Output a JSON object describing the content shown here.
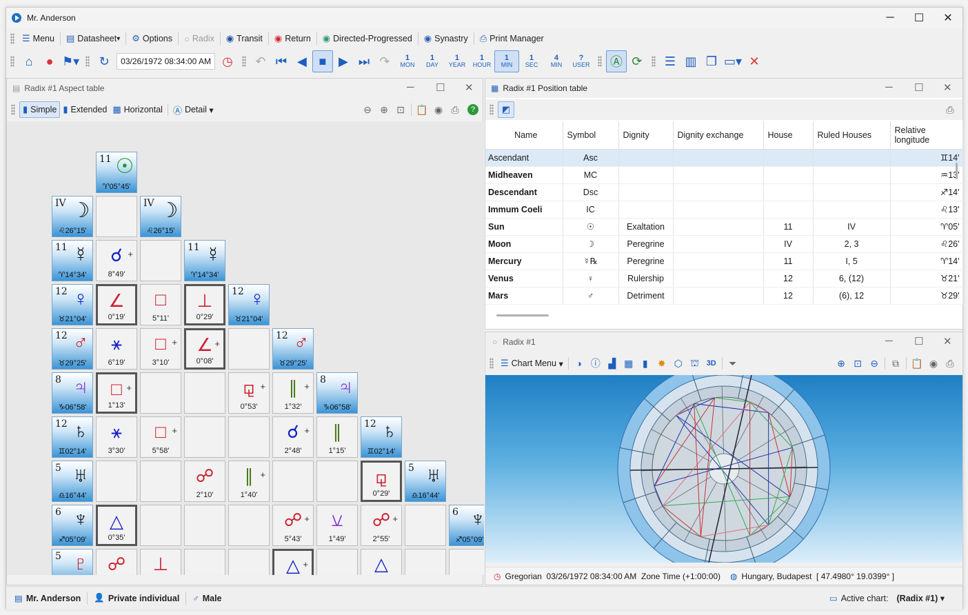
{
  "window": {
    "title": "Mr. Anderson"
  },
  "menubar": [
    {
      "label": "Menu",
      "icon": "hamburger-icon",
      "disabled": false
    },
    {
      "label": "Datasheet",
      "icon": "datasheet-icon",
      "disabled": false
    },
    {
      "label": "Options",
      "icon": "gear-icon",
      "disabled": false
    },
    {
      "label": "Radix",
      "icon": "radio-icon",
      "disabled": true
    },
    {
      "label": "Transit",
      "icon": "transit-icon",
      "disabled": false
    },
    {
      "label": "Return",
      "icon": "return-icon",
      "disabled": false
    },
    {
      "label": "Directed-Progressed",
      "icon": "progressed-icon",
      "disabled": false
    },
    {
      "label": "Synastry",
      "icon": "synastry-icon",
      "disabled": false
    },
    {
      "label": "Print Manager",
      "icon": "printer-icon",
      "disabled": false
    }
  ],
  "toolbar": {
    "datetime": "03/26/1972 08:34:00 AM",
    "steps": [
      {
        "top": "1",
        "label": "MON"
      },
      {
        "top": "1",
        "label": "DAY"
      },
      {
        "top": "1",
        "label": "YEAR"
      },
      {
        "top": "1",
        "label": "HOUR"
      },
      {
        "top": "1",
        "label": "MIN"
      },
      {
        "top": "1",
        "label": "SEC"
      },
      {
        "top": "4",
        "label": "MIN"
      },
      {
        "top": "?",
        "label": "USER"
      }
    ]
  },
  "aspect_panel": {
    "title": "Radix #1 Aspect table",
    "tools": {
      "simple": "Simple",
      "extended": "Extended",
      "horizontal": "Horizontal",
      "detail": "Detail"
    },
    "planets": [
      {
        "house": "11",
        "glyph": "☉",
        "pos": "♈05°45'",
        "color": "#1a9a2a"
      },
      {
        "house": "IV",
        "glyph": "☽",
        "pos": "♌26°15'",
        "color": "#111"
      },
      {
        "house": "11",
        "glyph": "☿",
        "pos": "♈14°34'",
        "color": "#111"
      },
      {
        "house": "12",
        "glyph": "♀",
        "pos": "♉21°04'",
        "color": "#1520c8"
      },
      {
        "house": "12",
        "glyph": "♂",
        "pos": "♉29°25'",
        "color": "#cc1f2f"
      },
      {
        "house": "8",
        "glyph": "♃",
        "pos": "♑06°58'",
        "color": "#8a2fd0"
      },
      {
        "house": "12",
        "glyph": "♄",
        "pos": "♊02°14'",
        "color": "#111"
      },
      {
        "house": "5",
        "glyph": "♅",
        "pos": "♎16°44'",
        "color": "#111"
      },
      {
        "house": "6",
        "glyph": "♆",
        "pos": "♐05°09'",
        "color": "#111"
      },
      {
        "house": "5",
        "glyph": "♇",
        "pos": "",
        "color": "#cc1f2f"
      }
    ],
    "aspects": [
      {
        "r": 3,
        "c": 1,
        "g": "☌",
        "col": "#1520c8",
        "orb": "8°49'",
        "plus": true,
        "bold": false
      },
      {
        "r": 4,
        "c": 1,
        "g": "∠",
        "col": "#cc1f2f",
        "orb": "0°19'",
        "plus": false,
        "bold": true
      },
      {
        "r": 4,
        "c": 2,
        "g": "□",
        "col": "#cc1f2f",
        "orb": "5°11'",
        "plus": false,
        "bold": false
      },
      {
        "r": 4,
        "c": 3,
        "g": "⊥",
        "col": "#cc1f2f",
        "orb": "0°29'",
        "plus": false,
        "bold": true
      },
      {
        "r": 5,
        "c": 1,
        "g": "⚹",
        "col": "#1520c8",
        "orb": "6°19'",
        "plus": false,
        "bold": false
      },
      {
        "r": 5,
        "c": 2,
        "g": "□",
        "col": "#cc1f2f",
        "orb": "3°10'",
        "plus": true,
        "bold": false
      },
      {
        "r": 5,
        "c": 3,
        "g": "∠",
        "col": "#cc1f2f",
        "orb": "0°08'",
        "plus": true,
        "bold": true
      },
      {
        "r": 6,
        "c": 1,
        "g": "□",
        "col": "#cc1f2f",
        "orb": "1°13'",
        "plus": true,
        "bold": true
      },
      {
        "r": 6,
        "c": 4,
        "g": "⚼",
        "col": "#cc1f2f",
        "orb": "0°53'",
        "plus": true,
        "bold": false
      },
      {
        "r": 6,
        "c": 5,
        "g": "∥",
        "col": "#4a7a1a",
        "orb": "1°32'",
        "plus": true,
        "bold": false
      },
      {
        "r": 7,
        "c": 1,
        "g": "⚹",
        "col": "#1520c8",
        "orb": "3°30'",
        "plus": false,
        "bold": false
      },
      {
        "r": 7,
        "c": 2,
        "g": "□",
        "col": "#cc1f2f",
        "orb": "5°58'",
        "plus": true,
        "bold": false
      },
      {
        "r": 7,
        "c": 5,
        "g": "☌",
        "col": "#1520c8",
        "orb": "2°48'",
        "plus": true,
        "bold": false
      },
      {
        "r": 7,
        "c": 6,
        "g": "∥",
        "col": "#4a7a1a",
        "orb": "1°15'",
        "plus": false,
        "bold": false
      },
      {
        "r": 8,
        "c": 3,
        "g": "☍",
        "col": "#cc1f2f",
        "orb": "2°10'",
        "plus": false,
        "bold": false
      },
      {
        "r": 8,
        "c": 4,
        "g": "∥",
        "col": "#4a7a1a",
        "orb": "1°40'",
        "plus": true,
        "bold": false
      },
      {
        "r": 8,
        "c": 7,
        "g": "⚼",
        "col": "#cc1f2f",
        "orb": "0°29'",
        "plus": false,
        "bold": true
      },
      {
        "r": 9,
        "c": 1,
        "g": "△",
        "col": "#1520c8",
        "orb": "0°35'",
        "plus": false,
        "bold": true
      },
      {
        "r": 9,
        "c": 5,
        "g": "☍",
        "col": "#cc1f2f",
        "orb": "5°43'",
        "plus": true,
        "bold": false
      },
      {
        "r": 9,
        "c": 6,
        "g": "⚺",
        "col": "#8a2fd0",
        "orb": "1°49'",
        "plus": false,
        "bold": false
      },
      {
        "r": 9,
        "c": 7,
        "g": "☍",
        "col": "#cc1f2f",
        "orb": "2°55'",
        "plus": true,
        "bold": false
      },
      {
        "r": 10,
        "c": 1,
        "g": "☍",
        "col": "#cc1f2f",
        "orb": "",
        "plus": false,
        "bold": false
      },
      {
        "r": 10,
        "c": 2,
        "g": "⊥",
        "col": "#cc1f2f",
        "orb": "",
        "plus": false,
        "bold": false
      },
      {
        "r": 10,
        "c": 5,
        "g": "△",
        "col": "#1520c8",
        "orb": "",
        "plus": true,
        "bold": true
      },
      {
        "r": 10,
        "c": 7,
        "g": "△",
        "col": "#1520c8",
        "orb": "",
        "plus": false,
        "bold": false
      }
    ]
  },
  "position_panel": {
    "title": "Radix #1 Position table",
    "columns": [
      "Name",
      "Symbol",
      "Dignity",
      "Dignity exchange",
      "House",
      "Ruled Houses",
      "Relative longitude"
    ],
    "rows": [
      {
        "name": "Ascendant",
        "symbol": "Asc",
        "dignity": "",
        "exchange": "",
        "house": "",
        "ruled": "",
        "lon": "♊14'"
      },
      {
        "name": "Midheaven",
        "symbol": "MC",
        "dignity": "",
        "exchange": "",
        "house": "",
        "ruled": "",
        "lon": "♒13'"
      },
      {
        "name": "Descendant",
        "symbol": "Dsc",
        "dignity": "",
        "exchange": "",
        "house": "",
        "ruled": "",
        "lon": "♐14'"
      },
      {
        "name": "Immum Coeli",
        "symbol": "IC",
        "dignity": "",
        "exchange": "",
        "house": "",
        "ruled": "",
        "lon": "♌13'"
      },
      {
        "name": "Sun",
        "symbol": "☉",
        "dignity": "Exaltation",
        "exchange": "",
        "house": "11",
        "ruled": "IV",
        "lon": "♈05'"
      },
      {
        "name": "Moon",
        "symbol": "☽",
        "dignity": "Peregrine",
        "exchange": "",
        "house": "IV",
        "ruled": "2, 3",
        "lon": "♌26'"
      },
      {
        "name": "Mercury",
        "symbol": "☿℞",
        "dignity": "Peregrine",
        "exchange": "",
        "house": "11",
        "ruled": "I, 5",
        "lon": "♈14'"
      },
      {
        "name": "Venus",
        "symbol": "♀",
        "dignity": "Rulership",
        "exchange": "",
        "house": "12",
        "ruled": "6, (12)",
        "lon": "♉21'"
      },
      {
        "name": "Mars",
        "symbol": "♂",
        "dignity": "Detriment",
        "exchange": "",
        "house": "12",
        "ruled": "(6), 12",
        "lon": "♉29'"
      }
    ]
  },
  "chart_panel": {
    "title": "Radix #1",
    "menu": "Chart Menu",
    "status": {
      "calendar": "Gregorian",
      "datetime": "03/26/1972 08:34:00 AM",
      "zone": "Zone Time (+1:00:00)",
      "place": "Hungary, Budapest",
      "coords": "[ 47.4980°  19.0399° ]"
    }
  },
  "bottombar": {
    "person": "Mr. Anderson",
    "type": "Private individual",
    "sex": "Male",
    "active_label": "Active chart:",
    "active_value": "(Radix #1)"
  }
}
